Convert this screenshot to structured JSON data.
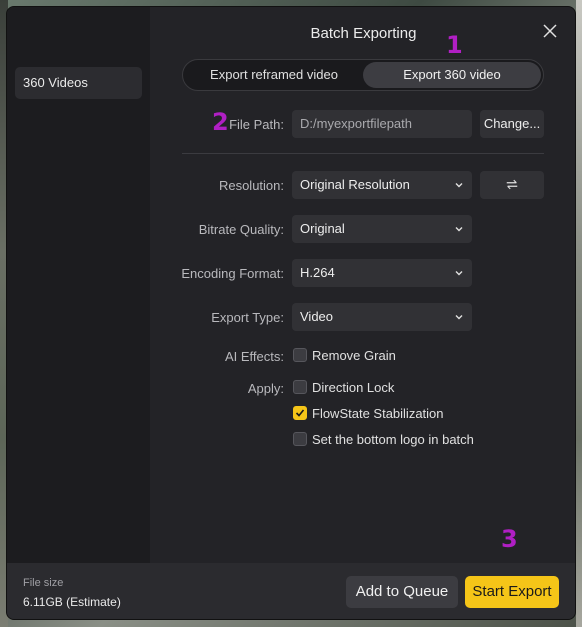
{
  "window": {
    "title": "Batch Exporting"
  },
  "sidebar": {
    "items": [
      {
        "label": "360 Videos"
      }
    ]
  },
  "tabs": {
    "reframed": "Export reframed video",
    "export360": "Export 360 video",
    "active": "export360"
  },
  "annotations": {
    "one": "1",
    "two": "2",
    "three": "3"
  },
  "file_path": {
    "label": "File Path:",
    "value": "D:/myexportfilepath",
    "change_label": "Change..."
  },
  "resolution": {
    "label": "Resolution:",
    "value": "Original Resolution",
    "swap_icon": "swap-arrows-icon"
  },
  "bitrate": {
    "label": "Bitrate Quality:",
    "value": "Original"
  },
  "encoding": {
    "label": "Encoding Format:",
    "value": "H.264"
  },
  "export_type": {
    "label": "Export Type:",
    "value": "Video"
  },
  "ai_effects": {
    "label": "AI Effects:",
    "options": [
      {
        "label": "Remove Grain",
        "checked": false
      }
    ]
  },
  "apply": {
    "label": "Apply:",
    "options": [
      {
        "label": "Direction Lock",
        "checked": false
      },
      {
        "label": "FlowState Stabilization",
        "checked": true
      },
      {
        "label": "Set the bottom logo in batch",
        "checked": false
      }
    ]
  },
  "footer": {
    "file_size_label": "File size",
    "file_size_value": "6.11GB (Estimate)",
    "queue_label": "Add to Queue",
    "export_label": "Start Export"
  },
  "colors": {
    "accent": "#f5c518",
    "annotation": "#b01fc4",
    "panel": "#232327"
  }
}
